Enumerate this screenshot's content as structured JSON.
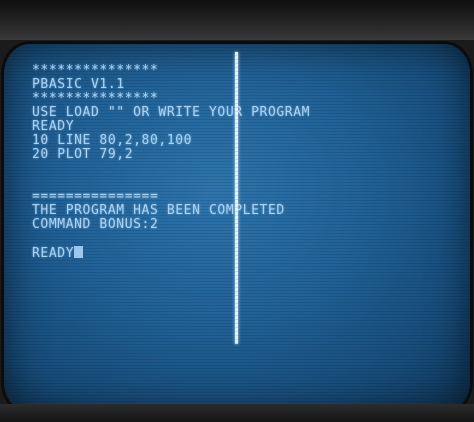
{
  "terminal": {
    "lines": [
      "***************",
      "PBASIC V1.1",
      "***************",
      "USE LOAD \"\" OR WRITE YOUR PROGRAM",
      "READY",
      "10 LINE 80,2,80,100",
      "20 PLOT 79,2",
      "",
      "",
      "===============",
      "THE PROGRAM HAS BEEN COMPLETED",
      "COMMAND BONUS:2",
      "",
      "READY"
    ]
  },
  "colors": {
    "screen": "#1f5f94",
    "text": "#a9d3f5",
    "plot_line": "#e6f3ff",
    "bezel": "#1b1b1b"
  }
}
